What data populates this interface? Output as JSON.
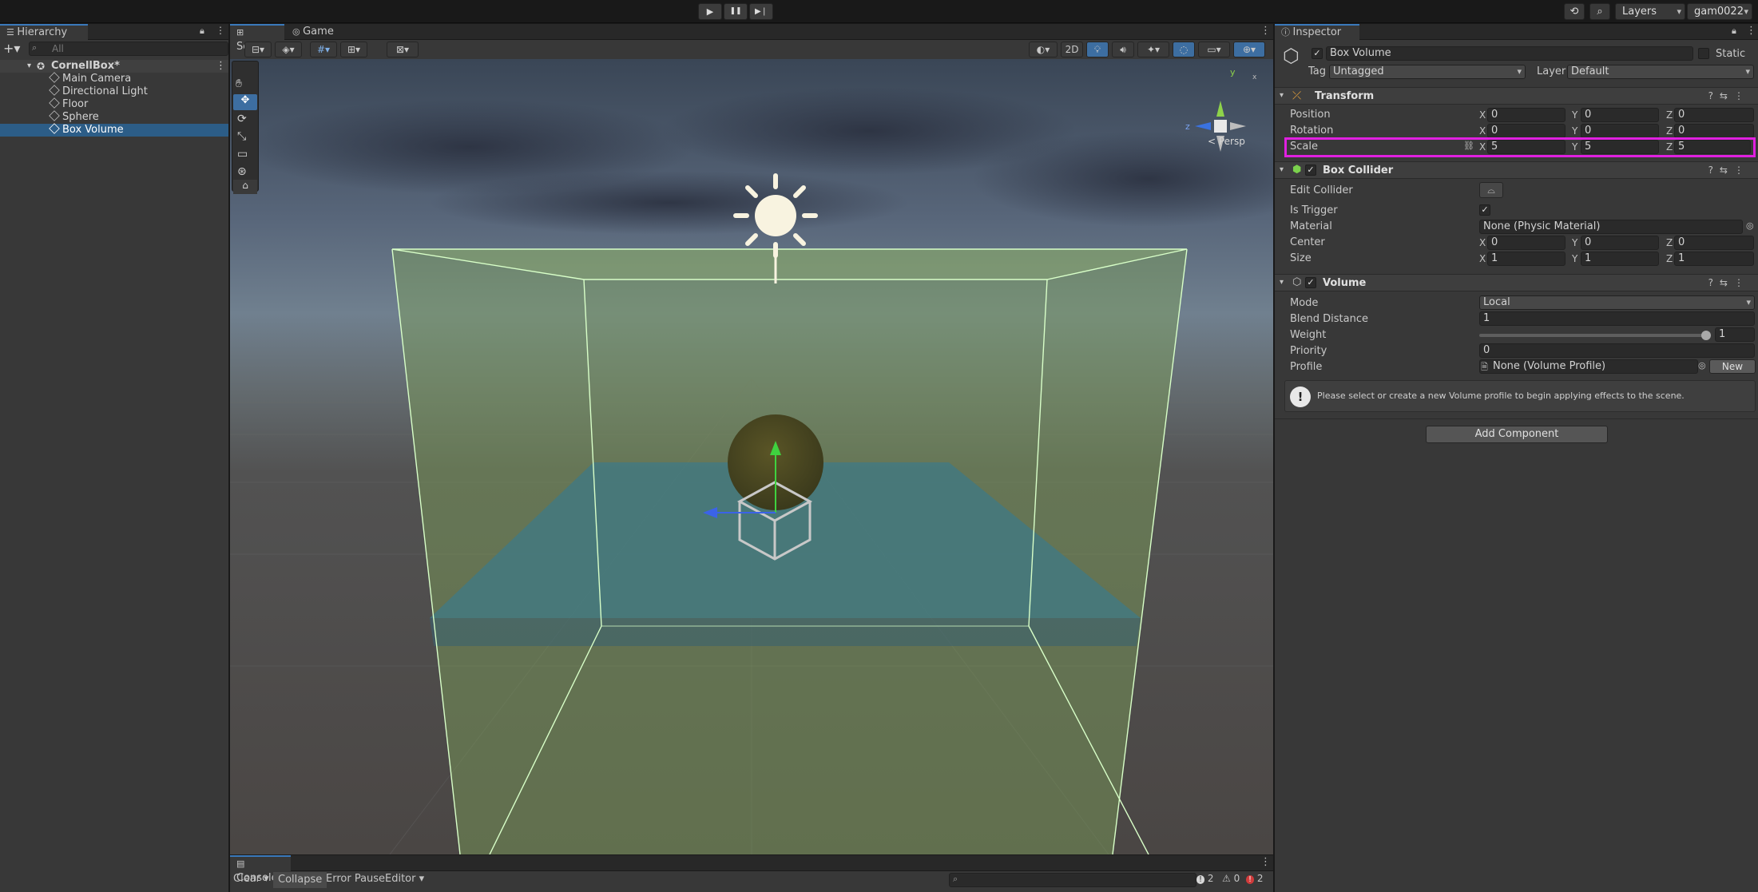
{
  "toolbar": {
    "play": "▶",
    "pause": "❚❚",
    "step": "▶❘",
    "layers_label": "Layers",
    "account_label": "gam0022"
  },
  "hierarchy": {
    "tab_label": "Hierarchy",
    "search_placeholder": "All",
    "scene_name": "CornellBox*",
    "items": [
      {
        "label": "Main Camera"
      },
      {
        "label": "Directional Light"
      },
      {
        "label": "Floor"
      },
      {
        "label": "Sphere"
      },
      {
        "label": "Box Volume"
      }
    ]
  },
  "scene": {
    "tabs": [
      {
        "label": "Scene"
      },
      {
        "label": "Game"
      }
    ],
    "mode_2d_label": "2D",
    "persp_label": "< Persp",
    "gizmo_axes": {
      "y": "y",
      "x": "x",
      "z": "z"
    }
  },
  "inspector": {
    "tab_label": "Inspector",
    "object_name": "Box Volume",
    "static_label": "Static",
    "tag_label": "Tag",
    "tag_value": "Untagged",
    "layer_label": "Layer",
    "layer_value": "Default",
    "transform": {
      "title": "Transform",
      "position_label": "Position",
      "rotation_label": "Rotation",
      "scale_label": "Scale",
      "position": {
        "x": "0",
        "y": "0",
        "z": "0"
      },
      "rotation": {
        "x": "0",
        "y": "0",
        "z": "0"
      },
      "scale": {
        "x": "5",
        "y": "5",
        "z": "5"
      }
    },
    "box_collider": {
      "title": "Box Collider",
      "edit_collider_label": "Edit Collider",
      "is_trigger_label": "Is Trigger",
      "material_label": "Material",
      "material_value": "None (Physic Material)",
      "center_label": "Center",
      "size_label": "Size",
      "center": {
        "x": "0",
        "y": "0",
        "z": "0"
      },
      "size": {
        "x": "1",
        "y": "1",
        "z": "1"
      }
    },
    "volume": {
      "title": "Volume",
      "mode_label": "Mode",
      "mode_value": "Local",
      "blend_distance_label": "Blend Distance",
      "blend_distance_value": "1",
      "weight_label": "Weight",
      "weight_value": "1",
      "weight_fraction": 1.0,
      "priority_label": "Priority",
      "priority_value": "0",
      "profile_label": "Profile",
      "profile_value": "None (Volume Profile)",
      "new_button": "New",
      "help_message": "Please select or create a new Volume profile to begin applying effects to the scene."
    },
    "add_component_label": "Add Component",
    "highlight_color": "#e020e0"
  },
  "console": {
    "tab_label": "Console",
    "clear_label": "Clear",
    "collapse_label": "Collapse",
    "error_pause_label": "Error Pause",
    "editor_label": "Editor",
    "info_count": "2",
    "warning_count": "0",
    "error_count": "2"
  }
}
